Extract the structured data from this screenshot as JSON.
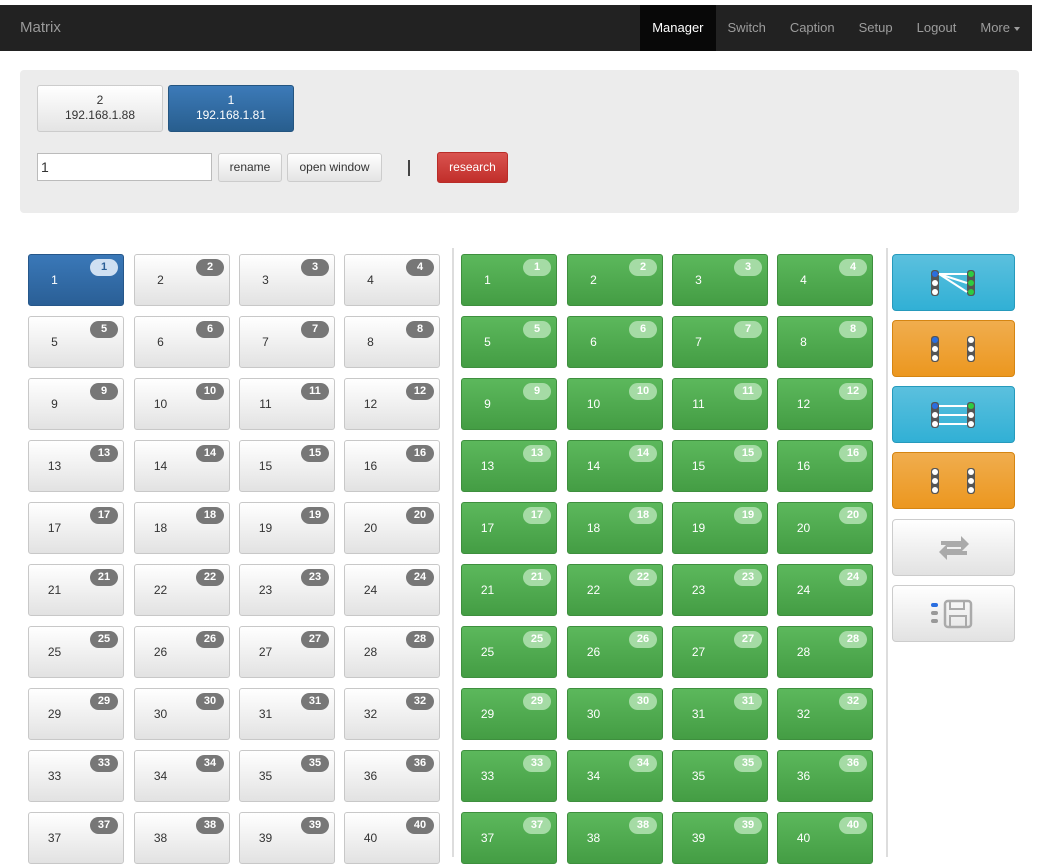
{
  "navbar": {
    "brand": "Matrix",
    "items": [
      {
        "label": "Manager",
        "active": true
      },
      {
        "label": "Switch",
        "active": false
      },
      {
        "label": "Caption",
        "active": false
      },
      {
        "label": "Setup",
        "active": false
      },
      {
        "label": "Logout",
        "active": false
      },
      {
        "label": "More",
        "active": false,
        "dropdown": true
      }
    ]
  },
  "devices": [
    {
      "id": "2",
      "ip": "192.168.1.88",
      "active": false
    },
    {
      "id": "1",
      "ip": "192.168.1.81",
      "active": true
    }
  ],
  "controls": {
    "name_value": "1",
    "rename_label": "rename",
    "open_window_label": "open window",
    "research_label": "research"
  },
  "inputs": {
    "count": 40,
    "active": 1
  },
  "outputs": {
    "count": 40
  },
  "tools": [
    {
      "name": "connect-tool",
      "icon": "matrix-connect-icon",
      "style": "info"
    },
    {
      "name": "disconnect-tool",
      "icon": "matrix-disconnect-icon",
      "style": "warn"
    },
    {
      "name": "connect-all-tool",
      "icon": "matrix-connect-all-icon",
      "style": "info"
    },
    {
      "name": "disconnect-all-tool",
      "icon": "matrix-disconnect-all-icon",
      "style": "warn"
    },
    {
      "name": "refresh-tool",
      "icon": "refresh-icon",
      "style": "def"
    },
    {
      "name": "save-tool",
      "icon": "save-icon",
      "style": "def"
    }
  ],
  "colors": {
    "primary": "#337ab7",
    "success": "#5cb85c",
    "info": "#5bc0de",
    "warning": "#f0ad4e",
    "danger": "#d9534f"
  }
}
